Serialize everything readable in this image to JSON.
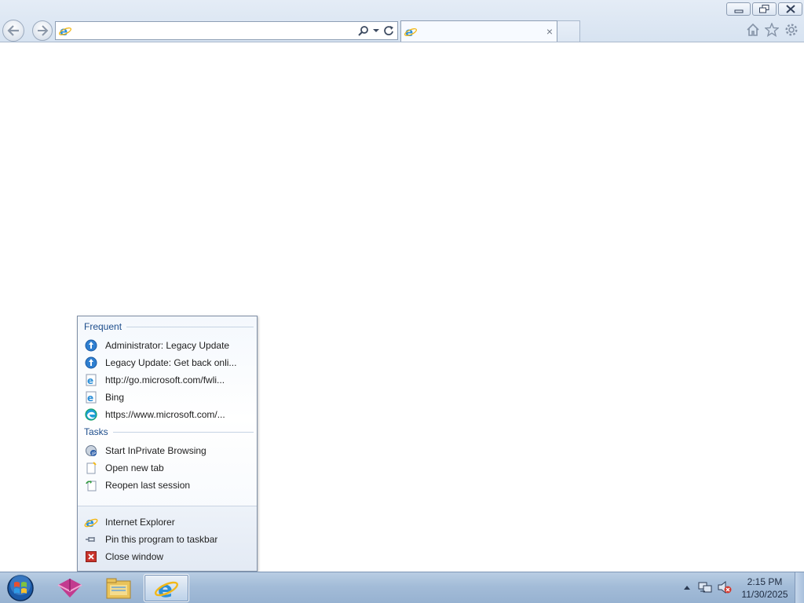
{
  "browser": {
    "address": {
      "value": "",
      "placeholder": ""
    },
    "tab": {
      "title": "",
      "close_glyph": "×"
    },
    "caption_buttons": [
      "minimize-icon",
      "restore-icon",
      "close-icon"
    ],
    "command_icons": [
      "home-icon",
      "favorites-star-icon",
      "tools-gear-icon"
    ]
  },
  "jumplist": {
    "frequent_header": "Frequent",
    "frequent": [
      {
        "label": "Administrator: Legacy Update",
        "icon": "legacy-update-globe-icon"
      },
      {
        "label": "Legacy Update: Get back onli...",
        "icon": "legacy-update-globe-icon"
      },
      {
        "label": "http://go.microsoft.com/fwli...",
        "icon": "ie-page-icon"
      },
      {
        "label": "Bing",
        "icon": "ie-page-icon"
      },
      {
        "label": "https://www.microsoft.com/...",
        "icon": "edge-icon"
      }
    ],
    "tasks_header": "Tasks",
    "tasks": [
      {
        "label": "Start InPrivate Browsing",
        "icon": "inprivate-icon"
      },
      {
        "label": "Open new tab",
        "icon": "new-tab-icon"
      },
      {
        "label": "Reopen last session",
        "icon": "reopen-session-icon"
      }
    ],
    "bottom": [
      {
        "label": "Internet Explorer",
        "icon": "internet-explorer-icon"
      },
      {
        "label": "Pin this program to taskbar",
        "icon": "pin-icon"
      },
      {
        "label": "Close window",
        "icon": "close-window-icon"
      }
    ]
  },
  "taskbar": {
    "apps": [
      "start-orb-icon",
      "legacy-update-app-icon",
      "file-explorer-icon",
      "internet-explorer-icon"
    ],
    "clock": {
      "time": "2:15 PM",
      "date": "11/30/2025"
    },
    "tray": [
      "show-hidden-icons-arrow",
      "network-icon",
      "volume-muted-icon"
    ]
  },
  "colors": {
    "header_text": "#1e4e8c",
    "taskbar": "#a3bcd8",
    "ie_blue": "#2b8fd8",
    "ie_ring": "#f2b818"
  }
}
